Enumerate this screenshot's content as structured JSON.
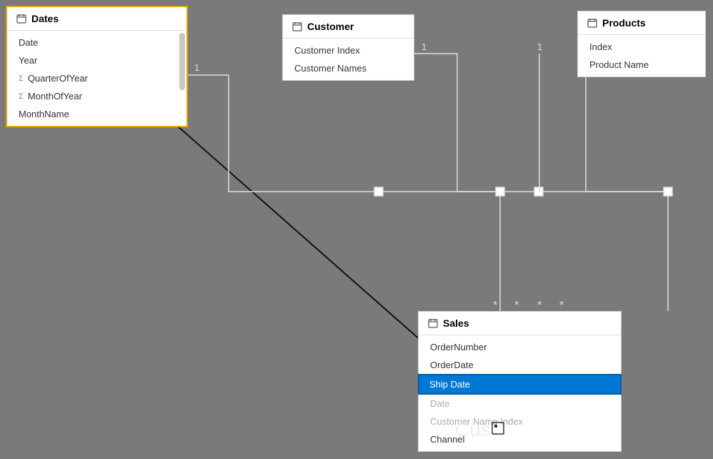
{
  "dates": {
    "title": "Dates",
    "fields": [
      {
        "name": "Date",
        "type": "normal",
        "selected": false
      },
      {
        "name": "Year",
        "type": "normal",
        "selected": false
      },
      {
        "name": "QuarterOfYear",
        "type": "sigma",
        "selected": false
      },
      {
        "name": "MonthOfYear",
        "type": "sigma",
        "selected": false
      },
      {
        "name": "MonthName",
        "type": "normal",
        "selected": false
      }
    ]
  },
  "customer": {
    "title": "Customer",
    "fields": [
      {
        "name": "Customer Index",
        "type": "normal"
      },
      {
        "name": "Customer Names",
        "type": "normal"
      }
    ]
  },
  "products": {
    "title": "Products",
    "fields": [
      {
        "name": "Index",
        "type": "normal"
      },
      {
        "name": "Product Name",
        "type": "normal"
      }
    ]
  },
  "sales": {
    "title": "Sales",
    "fields": [
      {
        "name": "OrderNumber",
        "type": "normal"
      },
      {
        "name": "OrderDate",
        "type": "normal"
      },
      {
        "name": "Ship Date",
        "type": "normal",
        "selected": true
      },
      {
        "name": "Date",
        "type": "normal"
      },
      {
        "name": "Customer Name Index",
        "type": "normal"
      },
      {
        "name": "Channel",
        "type": "normal"
      }
    ]
  },
  "cus_label": "Cus"
}
